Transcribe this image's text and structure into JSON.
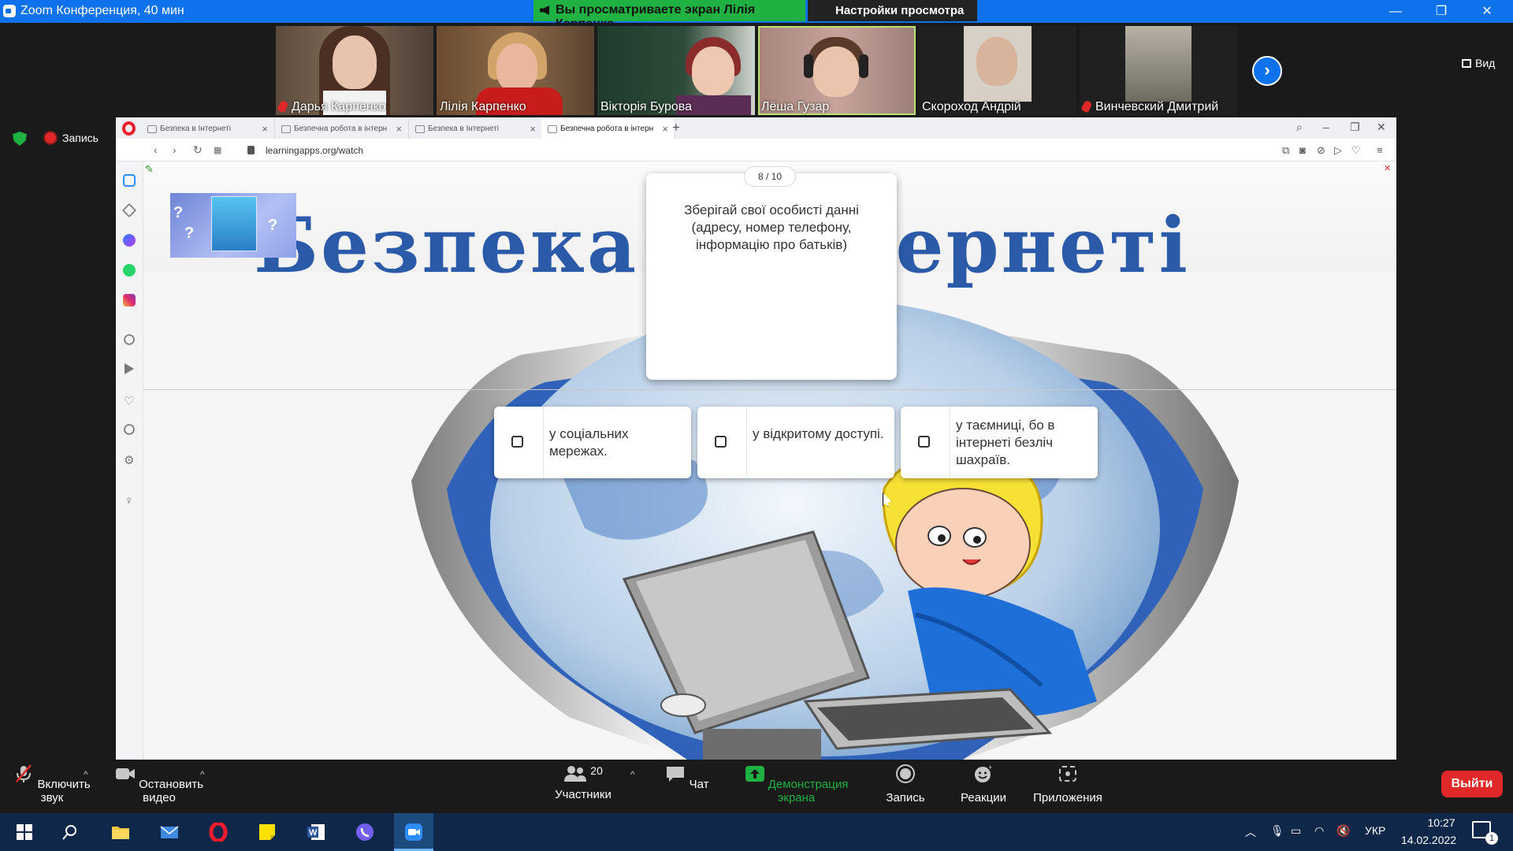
{
  "zoom": {
    "title": "Zoom Конференция, 40 мин",
    "share_banner": "Вы просматриваете экран Лілія Карпенко",
    "view_options": "Настройки просмотра",
    "view_button": "Вид",
    "recording": "Запись"
  },
  "participants": [
    {
      "name": "Дарья Карпенко",
      "muted": true
    },
    {
      "name": "Лілія Карпенко",
      "muted": false
    },
    {
      "name": "Вікторія Бурова",
      "muted": false
    },
    {
      "name": "Лёша Гузар",
      "muted": false
    },
    {
      "name": "Скороход Андрій",
      "muted": false
    },
    {
      "name": "Винчевский Дмитрий",
      "muted": true
    }
  ],
  "browser": {
    "tabs": [
      {
        "label": "Безпека в Інтернеті"
      },
      {
        "label": "Безпечна робота в інтерн"
      },
      {
        "label": "Безпека в Інтернеті"
      },
      {
        "label": "Безпечна робота в інтерн"
      }
    ],
    "url": "learningapps.org/watch"
  },
  "page": {
    "heading": "Безпека в Інтернеті",
    "quiz": {
      "counter": "8 / 10",
      "question": "Зберігай свої особисті данні (адресу, номер телефону, інформацію про батьків)",
      "answers": [
        {
          "text": "у соціальних мережах."
        },
        {
          "text": "у відкритому доступі."
        },
        {
          "text": "у таємниці, бо в інтернеті безліч шахраїв."
        }
      ]
    }
  },
  "controls": {
    "unmute": "Включить звук",
    "stop_video": "Остановить видео",
    "participants": "Участники",
    "participants_count": "20",
    "chat": "Чат",
    "share_screen": "Демонстрация экрана",
    "record": "Запись",
    "reactions": "Реакции",
    "apps": "Приложения",
    "leave": "Выйти"
  },
  "taskbar": {
    "language": "УКР",
    "time": "10:27",
    "date": "14.02.2022",
    "notifications": "1"
  },
  "colors": {
    "zoom_blue": "#0e72ed",
    "share_green": "#1fb141",
    "leave_red": "#e02828",
    "heading_blue": "#2b5aa8"
  }
}
